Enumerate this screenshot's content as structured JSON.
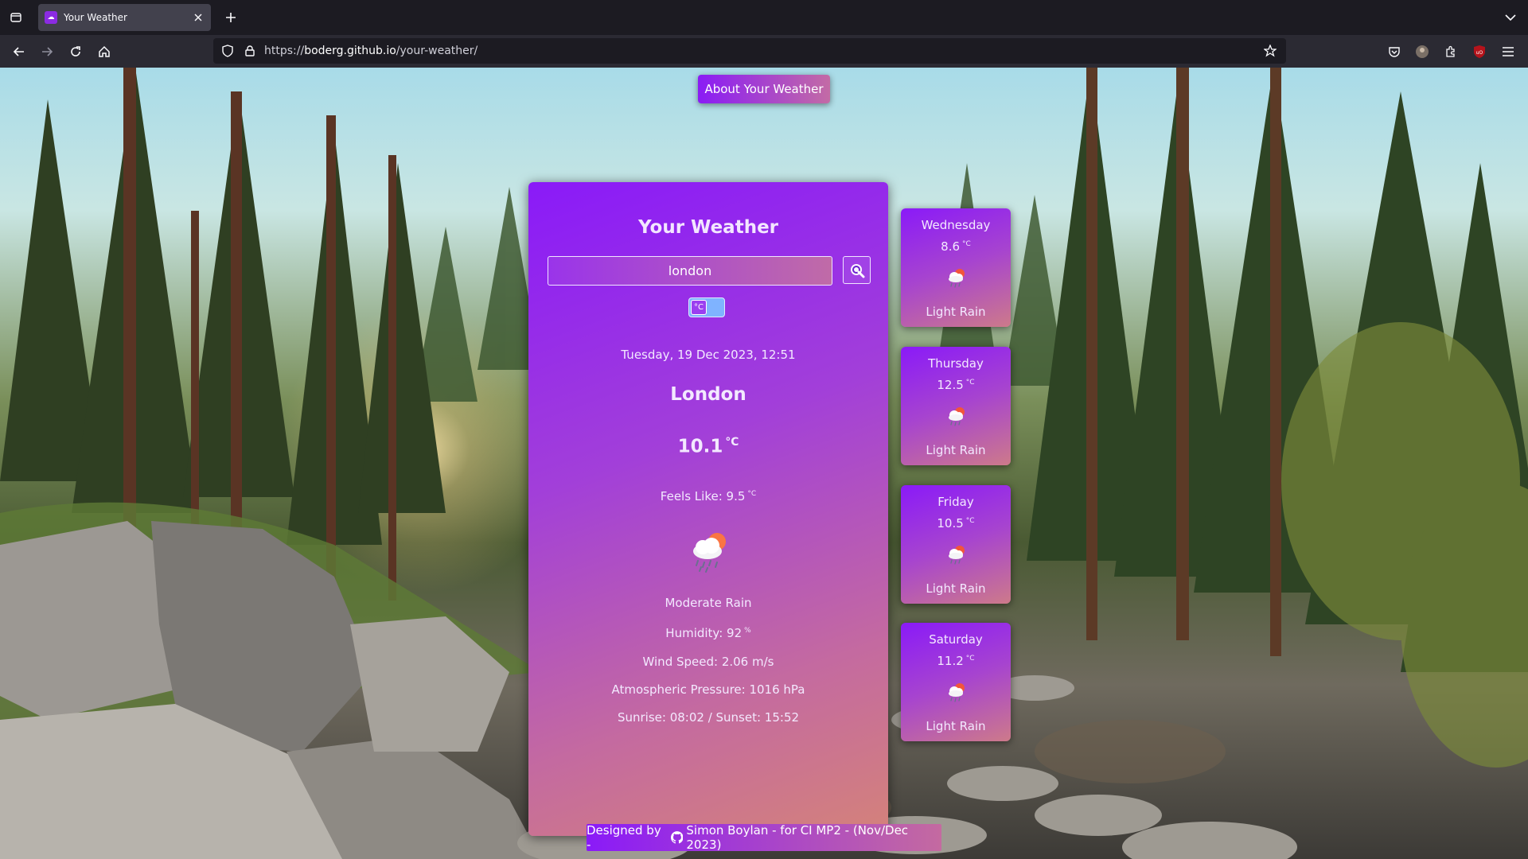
{
  "browser": {
    "tab": {
      "title": "Your Weather"
    },
    "url": {
      "prefix": "https://",
      "host": "boderg.github.io",
      "path": "/your-weather/"
    }
  },
  "page": {
    "about_button": "About Your Weather",
    "title": "Your Weather",
    "search": {
      "value": "london",
      "placeholder": ""
    },
    "unit_toggle": {
      "label": "°C"
    },
    "current": {
      "datetime": "Tuesday, 19 Dec 2023, 12:51",
      "city": "London",
      "temp": "10.1",
      "temp_unit": "°C",
      "feels_like_label": "Feels Like: 9.5",
      "feels_like_unit": "°C",
      "description": "Moderate Rain",
      "humidity_label": "Humidity: 92",
      "humidity_unit": "%",
      "wind": "Wind Speed: 2.06 m/s",
      "pressure": "Atmospheric Pressure: 1016 hPa",
      "sun": "Sunrise: 08:02 / Sunset: 15:52",
      "icon": "rain-cloud-sun-icon"
    },
    "forecast": [
      {
        "day": "Wednesday",
        "temp": "8.6",
        "unit": "°C",
        "description": "Light Rain",
        "icon": "rain-cloud-sun-icon"
      },
      {
        "day": "Thursday",
        "temp": "12.5",
        "unit": "°C",
        "description": "Light Rain",
        "icon": "rain-cloud-sun-icon"
      },
      {
        "day": "Friday",
        "temp": "10.5",
        "unit": "°C",
        "description": "Light Rain",
        "icon": "rain-cloud-sun-icon"
      },
      {
        "day": "Saturday",
        "temp": "11.2",
        "unit": "°C",
        "description": "Light Rain",
        "icon": "rain-cloud-sun-icon"
      }
    ],
    "footer": {
      "prefix": "Designed by -",
      "suffix": "Simon Boylan - for CI MP2 - (Nov/Dec 2023)"
    }
  },
  "colors": {
    "card_start": "#8a1af8",
    "card_end": "#d4827a",
    "chrome_dark": "#1c1b22",
    "chrome_mid": "#2b2a33"
  }
}
